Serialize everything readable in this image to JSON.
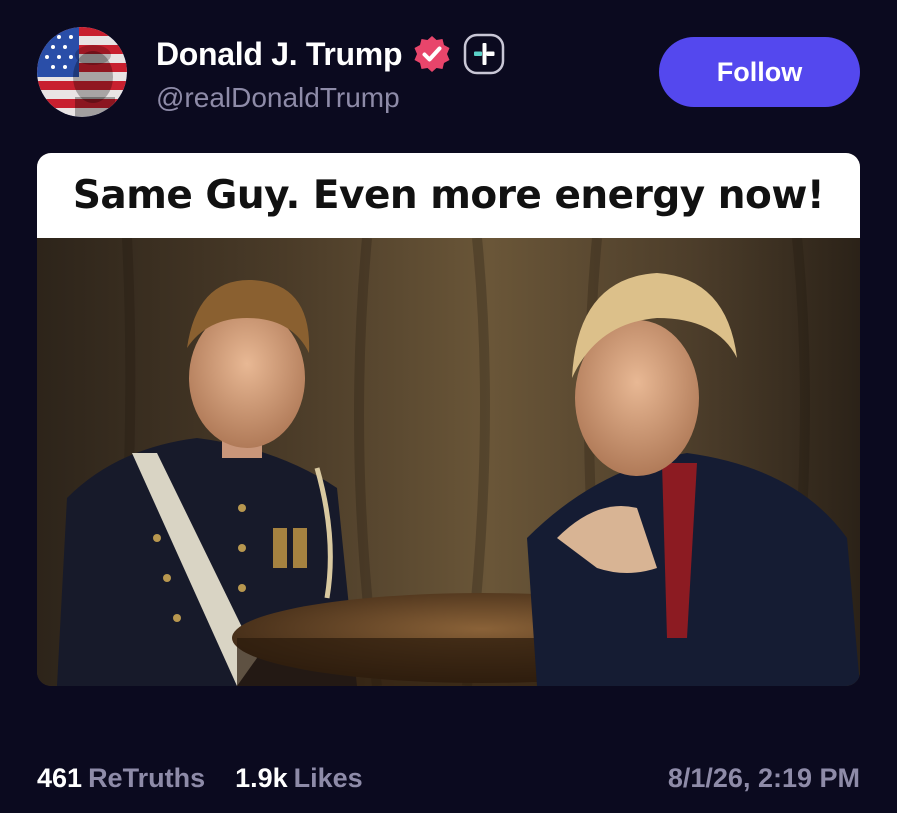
{
  "author": {
    "display_name": "Donald J. Trump",
    "handle": "@realDonaldTrump",
    "avatar_icon": "flag-portrait-avatar",
    "verified_icon": "verified-badge-icon",
    "verified_color": "#e8456b",
    "plus_badge_icon": "plus-badge-icon"
  },
  "actions": {
    "follow_label": "Follow",
    "follow_color": "#5448ee"
  },
  "media": {
    "caption": "Same Guy. Even more energy now!"
  },
  "stats": {
    "retruths_count": "461",
    "retruths_label": "ReTruths",
    "likes_count": "1.9k",
    "likes_label": "Likes"
  },
  "timestamp": "8/1/26, 2:19 PM",
  "colors": {
    "background": "#0b0a1f",
    "muted_text": "#8e8ba8"
  }
}
